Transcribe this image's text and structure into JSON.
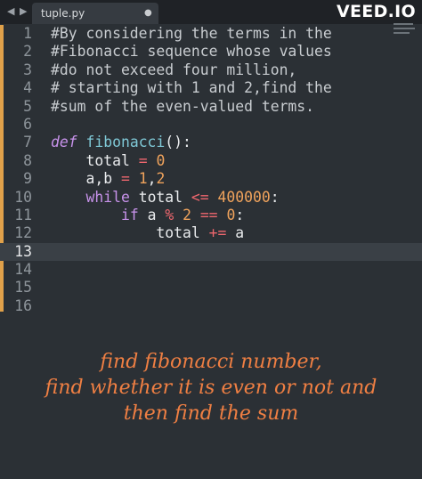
{
  "tabbar": {
    "nav_arrows": "◀ ▶",
    "tab_name": "tuple.py",
    "tab_modified_dot": "●"
  },
  "watermark": {
    "brand": "VEED.IO"
  },
  "editor": {
    "active_line": 13,
    "lines": [
      {
        "n": "1",
        "tokens": [
          {
            "t": "#By considering the terms in the",
            "c": "cmt"
          }
        ]
      },
      {
        "n": "2",
        "tokens": [
          {
            "t": "#Fibonacci sequence whose values",
            "c": "cmt"
          }
        ]
      },
      {
        "n": "3",
        "tokens": [
          {
            "t": "#do not exceed four million,",
            "c": "cmt"
          }
        ]
      },
      {
        "n": "4",
        "tokens": [
          {
            "t": "# starting with 1 and 2,find the",
            "c": "cmt"
          }
        ]
      },
      {
        "n": "5",
        "tokens": [
          {
            "t": "#sum of the even-valued terms.",
            "c": "cmt"
          }
        ]
      },
      {
        "n": "6",
        "tokens": []
      },
      {
        "n": "7",
        "tokens": [
          {
            "t": "def",
            "c": "kwi"
          },
          {
            "t": " ",
            "c": "plain"
          },
          {
            "t": "fibonacci",
            "c": "fn"
          },
          {
            "t": "():",
            "c": "plain"
          }
        ]
      },
      {
        "n": "8",
        "tokens": [
          {
            "t": "    total ",
            "c": "plain"
          },
          {
            "t": "=",
            "c": "op"
          },
          {
            "t": " ",
            "c": "plain"
          },
          {
            "t": "0",
            "c": "num"
          }
        ]
      },
      {
        "n": "9",
        "tokens": [
          {
            "t": "    a,b ",
            "c": "plain"
          },
          {
            "t": "=",
            "c": "op"
          },
          {
            "t": " ",
            "c": "plain"
          },
          {
            "t": "1",
            "c": "num"
          },
          {
            "t": ",",
            "c": "plain"
          },
          {
            "t": "2",
            "c": "num"
          }
        ]
      },
      {
        "n": "10",
        "tokens": [
          {
            "t": "    ",
            "c": "plain"
          },
          {
            "t": "while",
            "c": "kw"
          },
          {
            "t": " total ",
            "c": "plain"
          },
          {
            "t": "<=",
            "c": "op"
          },
          {
            "t": " ",
            "c": "plain"
          },
          {
            "t": "400000",
            "c": "num"
          },
          {
            "t": ":",
            "c": "plain"
          }
        ]
      },
      {
        "n": "11",
        "tokens": [
          {
            "t": "        ",
            "c": "plain"
          },
          {
            "t": "if",
            "c": "kw"
          },
          {
            "t": " a ",
            "c": "plain"
          },
          {
            "t": "%",
            "c": "op"
          },
          {
            "t": " ",
            "c": "plain"
          },
          {
            "t": "2",
            "c": "num"
          },
          {
            "t": " ",
            "c": "plain"
          },
          {
            "t": "==",
            "c": "op"
          },
          {
            "t": " ",
            "c": "plain"
          },
          {
            "t": "0",
            "c": "num"
          },
          {
            "t": ":",
            "c": "plain"
          }
        ]
      },
      {
        "n": "12",
        "tokens": [
          {
            "t": "            total ",
            "c": "plain"
          },
          {
            "t": "+=",
            "c": "op"
          },
          {
            "t": " a",
            "c": "plain"
          }
        ]
      },
      {
        "n": "13",
        "tokens": []
      },
      {
        "n": "14",
        "tokens": []
      },
      {
        "n": "15",
        "tokens": []
      },
      {
        "n": "16",
        "tokens": []
      }
    ]
  },
  "caption": {
    "line1": "find fibonacci number,",
    "line2": "find whether it is even or not and",
    "line3": "then find the sum"
  },
  "colors": {
    "background": "#2b3035",
    "caption": "#ef7f43",
    "keyword": "#c792ea",
    "function": "#7fc8d6",
    "number": "#f0a35c",
    "operator": "#f0676e",
    "gutter_marker": "#e0a14a"
  }
}
